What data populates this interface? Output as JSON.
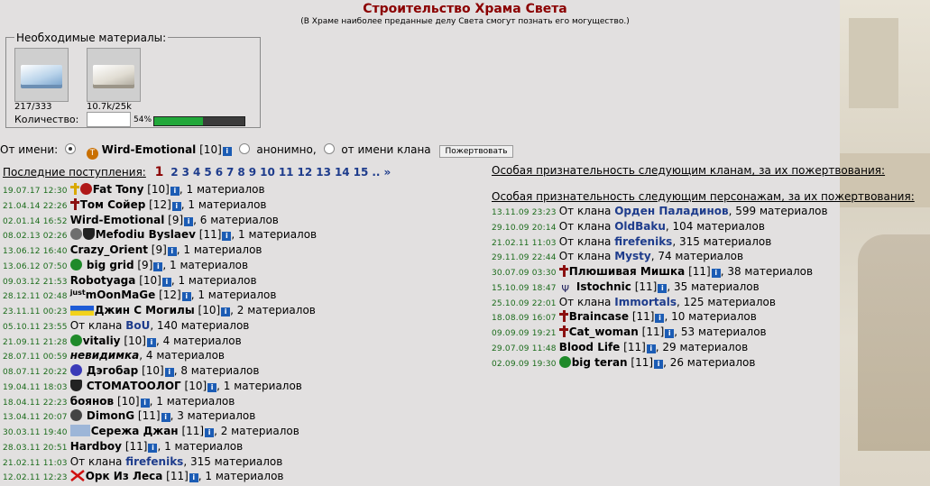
{
  "title": "Строительство Храма Света",
  "subtitle": "(В Храме наиболее преданные делу Света смогут познать его могущество.)",
  "materials": {
    "legend": "Необходимые материалы:",
    "items": [
      {
        "count": "217/333",
        "icon": "blue-stone-slab-icon"
      },
      {
        "count": "10.7k/25k",
        "icon": "gray-stone-slab-icon"
      }
    ],
    "qty_label": "Количество:",
    "qty_value": "",
    "percent": "54%",
    "progress_fraction": 0.54
  },
  "from": {
    "label": "От имени:",
    "self_name": "Wird-Emotional",
    "self_level": "[10]",
    "anon": "анонимно,",
    "clan": "от имени клана",
    "donate": "Пожертвовать"
  },
  "pager": {
    "label": "Последние поступления:",
    "current": "1",
    "pages": [
      "2",
      "3",
      "4",
      "5",
      "6",
      "7",
      "8",
      "9",
      "10",
      "11",
      "12",
      "13",
      "14",
      "15",
      "..",
      "»"
    ]
  },
  "info_glyph": "i",
  "left_rows": [
    {
      "ts": "19.07.17 12:30",
      "icons": [
        "gold-cross",
        "red-ball"
      ],
      "name": "Fat Tony",
      "lvl": "[10]",
      "info": true,
      "tail": ", 1 материалов"
    },
    {
      "ts": "21.04.14 22:26",
      "icons": [
        "red-cross"
      ],
      "name": "Том Сойер",
      "lvl": "[12]",
      "info": true,
      "tail": ", 1 материалов"
    },
    {
      "ts": "02.01.14 16:52",
      "icons": [],
      "name": "Wird-Emotional",
      "lvl": "[9]",
      "info": true,
      "tail": ", 6 материалов"
    },
    {
      "ts": "08.02.13 02:26",
      "icons": [
        "medal",
        "shield"
      ],
      "name": "Mefodiu Byslaev",
      "lvl": "[11]",
      "info": true,
      "tail": ", 1 материалов"
    },
    {
      "ts": "13.06.12 16:40",
      "icons": [],
      "name": "Crazy_Orient",
      "lvl": "[9]",
      "info": true,
      "tail": ", 1 материалов"
    },
    {
      "ts": "13.06.12 07:50",
      "icons": [
        "green-orb"
      ],
      "name": " big grid",
      "lvl": "[9]",
      "info": true,
      "tail": ", 1 материалов"
    },
    {
      "ts": "09.03.12 21:53",
      "icons": [],
      "name": "Robotyaga",
      "lvl": "[10]",
      "info": true,
      "tail": ", 1 материалов"
    },
    {
      "ts": "28.12.11 02:48",
      "icons": [
        "just"
      ],
      "name": "mOonMaGe",
      "lvl": "[12]",
      "info": true,
      "tail": ", 1 материалов"
    },
    {
      "ts": "23.11.11 00:23",
      "icons": [
        "flag"
      ],
      "name": "Джин С Могилы",
      "lvl": "[10]",
      "info": true,
      "tail": ", 2 материалов"
    },
    {
      "ts": "05.10.11 23:55",
      "clan_prefix": "От клана",
      "clan": "BoU",
      "tail": ", 140 материалов"
    },
    {
      "ts": "21.09.11 21:28",
      "icons": [
        "green-orb"
      ],
      "name": "vitaliy",
      "lvl": "[10]",
      "info": true,
      "tail": ", 4 материалов"
    },
    {
      "ts": "28.07.11 00:59",
      "icons": [],
      "name": "невидимка",
      "italic": true,
      "tail": ", 4 материалов"
    },
    {
      "ts": "08.07.11 20:22",
      "icons": [
        "blue-eye"
      ],
      "name": " Дэгобар",
      "lvl": "[10]",
      "info": true,
      "tail": ", 8 материалов"
    },
    {
      "ts": "19.04.11 18:03",
      "icons": [
        "shield"
      ],
      "name": " СТОМАТООЛОГ",
      "lvl": "[10]",
      "info": true,
      "tail": ", 1 материалов"
    },
    {
      "ts": "18.04.11 22:23",
      "icons": [],
      "name": "боянов",
      "lvl": "[10]",
      "info": true,
      "tail": ", 1 материалов"
    },
    {
      "ts": "13.04.11 20:07",
      "icons": [
        "wheel"
      ],
      "name": " DimonG",
      "lvl": "[11]",
      "info": true,
      "tail": ", 3 материалов"
    },
    {
      "ts": "30.03.11 19:40",
      "icons": [
        "crest"
      ],
      "name": "Сережа Джан",
      "lvl": "[11]",
      "info": true,
      "tail": ", 2 материалов"
    },
    {
      "ts": "28.03.11 20:51",
      "icons": [],
      "name": "Hardboy",
      "lvl": "[11]",
      "info": true,
      "tail": ", 1 материалов"
    },
    {
      "ts": "21.02.11 11:03",
      "clan_prefix": "От клана",
      "clan": "firefeniks",
      "tail": ", 315 материалов"
    },
    {
      "ts": "12.02.11 12:23",
      "icons": [
        "red-x"
      ],
      "name": "Орк Из Леса",
      "lvl": "[11]",
      "info": true,
      "tail": ", 1 материалов"
    }
  ],
  "right": {
    "clans_heading": "Особая признательность следующим кланам, за их пожертвования:",
    "persons_heading": "Особая признательность следующим персонажам, за их пожертвования:",
    "rows": [
      {
        "ts": "13.11.09 23:23",
        "clan_prefix": "От клана",
        "clan": "Орден Паладинов",
        "tail": ", 599 материалов"
      },
      {
        "ts": "29.10.09 20:14",
        "clan_prefix": "От клана",
        "clan": "OldBaku",
        "tail": ", 104 материалов"
      },
      {
        "ts": "21.02.11 11:03",
        "clan_prefix": "От клана",
        "clan": "firefeniks",
        "tail": ", 315 материалов"
      },
      {
        "ts": "29.11.09 22:44",
        "clan_prefix": "От клана",
        "clan": "Mysty",
        "tail": ", 74 материалов"
      },
      {
        "ts": "30.07.09 03:30",
        "icons": [
          "red-cross"
        ],
        "name": "Плюшивая Мишка",
        "lvl": "[11]",
        "info": true,
        "tail": ", 38 материалов"
      },
      {
        "ts": "15.10.09 18:47",
        "icons": [
          "trident"
        ],
        "name": " Istochnic",
        "lvl": "[11]",
        "info": true,
        "tail": ", 35 материалов"
      },
      {
        "ts": "25.10.09 22:01",
        "clan_prefix": "От клана",
        "clan": "Immortals",
        "tail": ", 125 материалов"
      },
      {
        "ts": "18.08.09 16:07",
        "icons": [
          "red-cross"
        ],
        "name": "Braincase",
        "lvl": "[11]",
        "info": true,
        "tail": ", 10 материалов"
      },
      {
        "ts": "09.09.09 19:21",
        "icons": [
          "red-cross"
        ],
        "name": "Cat_woman",
        "lvl": "[11]",
        "info": true,
        "tail": ", 53 материалов"
      },
      {
        "ts": "29.07.09 11:48",
        "icons": [],
        "name": "Blood Life",
        "lvl": "[11]",
        "info": true,
        "tail": ", 29 материалов"
      },
      {
        "ts": "02.09.09 19:30",
        "icons": [
          "green-orb"
        ],
        "name": "big teran",
        "lvl": "[11]",
        "info": true,
        "tail": ", 26 материалов"
      }
    ]
  }
}
